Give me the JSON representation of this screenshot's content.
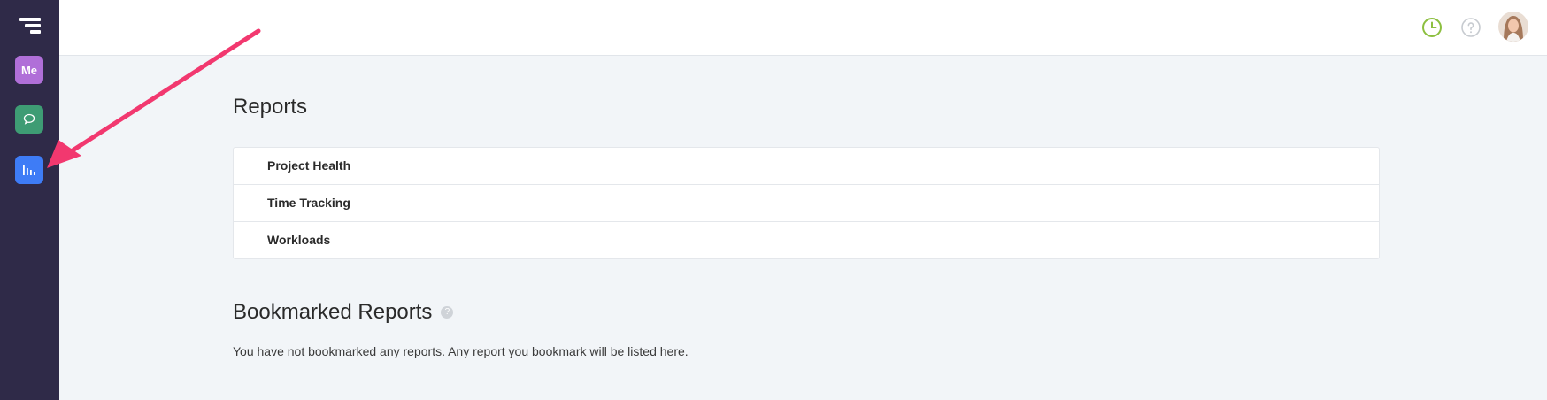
{
  "sidebar": {
    "items": [
      {
        "label": "Me",
        "icon": "me-icon"
      },
      {
        "label": "",
        "icon": "chat-icon"
      },
      {
        "label": "",
        "icon": "bar-chart-icon"
      }
    ]
  },
  "topbar": {
    "icons": [
      "clock-icon",
      "help-icon",
      "user-avatar"
    ]
  },
  "reports": {
    "title": "Reports",
    "items": [
      "Project Health",
      "Time Tracking",
      "Workloads"
    ]
  },
  "bookmarked": {
    "title": "Bookmarked Reports",
    "help_glyph": "?",
    "empty_text": "You have not bookmarked any reports. Any report you bookmark will be listed here."
  },
  "colors": {
    "sidebar_bg": "#2f2a48",
    "me": "#b06fd8",
    "chat": "#3e9c74",
    "reports": "#3e7cf6",
    "annotation_arrow": "#f2386f",
    "clock": "#8cbf3f"
  }
}
